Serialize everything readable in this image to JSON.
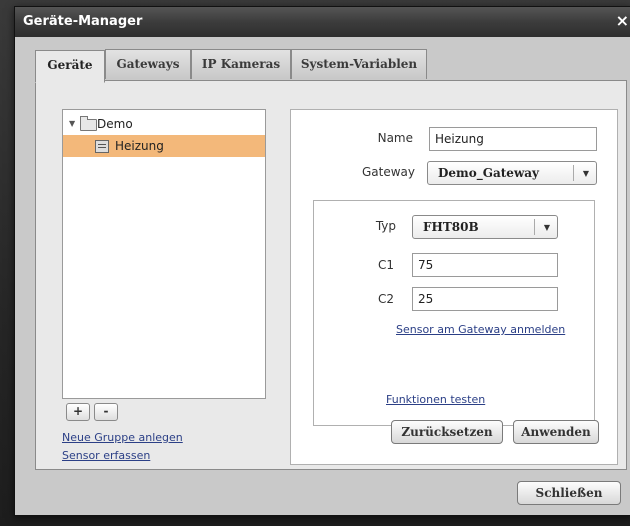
{
  "window": {
    "title": "Geräte-Manager",
    "close_glyph": "×",
    "close_icon": "close-icon"
  },
  "tabs": [
    {
      "label": "Geräte",
      "active": true
    },
    {
      "label": "Gateways",
      "active": false
    },
    {
      "label": "IP Kameras",
      "active": false
    },
    {
      "label": "System-Variablen",
      "active": false
    }
  ],
  "tree": {
    "items": [
      {
        "label": "Demo",
        "icon": "folder-icon",
        "expanded": true,
        "selected": false
      },
      {
        "label": "Heizung",
        "icon": "device-icon",
        "selected": true
      }
    ],
    "expand_glyph": "▼",
    "add_label": "+",
    "remove_label": "-"
  },
  "links": {
    "new_group": "Neue Gruppe anlegen",
    "register_sensor": "Sensor erfassen"
  },
  "form": {
    "name_label": "Name",
    "name_value": "Heizung",
    "gateway_label": "Gateway",
    "gateway_value": "Demo_Gateway",
    "type_label": "Typ",
    "type_value": "FHT80B",
    "c1_label": "C1",
    "c1_value": "75",
    "c2_label": "C2",
    "c2_value": "25",
    "sensor_link": "Sensor am Gateway anmelden",
    "test_link": "Funktionen testen",
    "reset_button": "Zurücksetzen",
    "apply_button": "Anwenden",
    "dropdown_glyph": "▼"
  },
  "footer": {
    "close_button": "Schließen"
  },
  "colors": {
    "selected_row": "#f3b87a",
    "link": "#2b3f86",
    "titlebar": "#3c3c3c"
  }
}
